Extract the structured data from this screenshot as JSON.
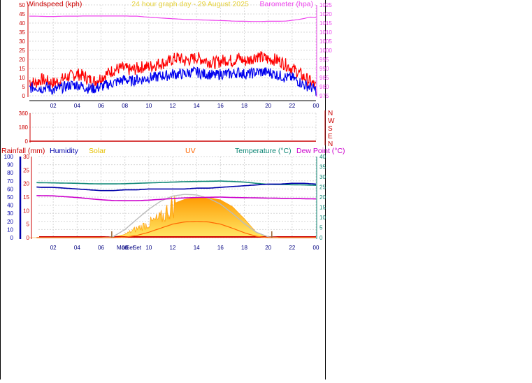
{
  "header": {
    "title": "24 hour graph day - 29 August 2025",
    "title_color": "#e6d23c"
  },
  "time_labels": [
    "02",
    "04",
    "06",
    "08",
    "10",
    "12",
    "14",
    "16",
    "18",
    "20",
    "22",
    "00"
  ],
  "colors": {
    "wind_gust": "#ff0000",
    "wind_avg": "#0000ee",
    "pressure": "#ee44ee",
    "direction": "#cc0000",
    "rainfall": "#cc0000",
    "humidity": "#0000aa",
    "solar": "#e6c000",
    "uv": "#ff6600",
    "temperature": "#118877",
    "dew_point": "#cc00cc",
    "grid": "#d8d8d8",
    "axis_frame": "#000000"
  },
  "chart_data": [
    {
      "type": "line",
      "name": "wind-pressure",
      "legend": {
        "left": "Windspeed (kph)",
        "right": "Barometer (hpa)"
      },
      "x": [
        0,
        0.5,
        1,
        1.5,
        2,
        2.5,
        3,
        3.5,
        4,
        4.5,
        5,
        5.5,
        6,
        6.5,
        7,
        7.5,
        8,
        8.5,
        9,
        9.5,
        10,
        10.5,
        11,
        11.5,
        12,
        12.5,
        13,
        13.5,
        14,
        14.5,
        15,
        15.5,
        16,
        16.5,
        17,
        17.5,
        18,
        18.5,
        19,
        19.5,
        20,
        20.5,
        21,
        21.5,
        22,
        22.5,
        23,
        23.5,
        24
      ],
      "xlim": [
        0,
        24
      ],
      "y_left": {
        "ticks": [
          0,
          5,
          10,
          15,
          20,
          25,
          30,
          35,
          40,
          45,
          50
        ],
        "ylim": [
          0,
          50
        ]
      },
      "y_right": {
        "ticks": [
          975,
          980,
          985,
          990,
          995,
          1000,
          1005,
          1010,
          1015,
          1020,
          1025
        ],
        "ylim": [
          975,
          1025
        ]
      },
      "series": [
        {
          "name": "Gust",
          "axis": "left",
          "color": "#ff0000",
          "values": [
            8,
            7,
            9,
            8,
            7,
            8,
            10,
            11,
            12,
            11,
            9,
            8,
            10,
            12,
            14,
            15,
            15,
            14,
            15,
            16,
            16,
            17,
            18,
            18,
            20,
            21,
            19,
            20,
            21,
            20,
            19,
            18,
            19,
            20,
            19,
            21,
            19,
            20,
            22,
            21,
            20,
            20,
            19,
            17,
            15,
            13,
            10,
            8,
            5
          ]
        },
        {
          "name": "Average",
          "axis": "left",
          "color": "#0000ee",
          "values": [
            4,
            5,
            4,
            5,
            3,
            4,
            5,
            6,
            6,
            5,
            4,
            4,
            5,
            6,
            7,
            8,
            9,
            8,
            9,
            9,
            10,
            10,
            11,
            11,
            12,
            12,
            12,
            13,
            13,
            12,
            12,
            11,
            12,
            12,
            12,
            13,
            12,
            12,
            13,
            13,
            13,
            12,
            11,
            10,
            10,
            8,
            6,
            5,
            3
          ]
        },
        {
          "name": "Pressure",
          "axis": "right",
          "color": "#ee44ee",
          "values": [
            1018.8,
            1018.8,
            1018.7,
            1018.6,
            1018.6,
            1018.7,
            1018.8,
            1018.8,
            1018.8,
            1018.9,
            1018.9,
            1018.9,
            1018.9,
            1018.9,
            1018.9,
            1018.9,
            1018.9,
            1018.8,
            1018.8,
            1018.5,
            1018.2,
            1018.0,
            1017.8,
            1017.6,
            1017.4,
            1017.2,
            1017.0,
            1016.9,
            1016.8,
            1016.7,
            1016.6,
            1016.5,
            1016.4,
            1016.3,
            1016.1,
            1016.0,
            1016.0,
            1015.9,
            1015.9,
            1015.9,
            1016.0,
            1016.0,
            1016.0,
            1016.1,
            1016.5,
            1016.9,
            1017.5,
            1018.3,
            1018.0
          ]
        }
      ]
    },
    {
      "type": "line",
      "name": "wind-direction",
      "x": [
        0,
        24
      ],
      "xlim": [
        0,
        24
      ],
      "y_left": {
        "ticks": [
          0,
          180,
          360
        ],
        "ylim": [
          0,
          360
        ]
      },
      "compass_labels": [
        "N",
        "W",
        "S",
        "E",
        "N"
      ],
      "series": [
        {
          "name": "Direction",
          "color": "#cc0000",
          "values": [
            0,
            0
          ]
        }
      ]
    },
    {
      "type": "area",
      "name": "rain-humidity-solar-temp",
      "legend": {
        "rainfall": "Rainfall (mm)",
        "humidity": "Humidity",
        "solar": "Solar",
        "uv": "UV",
        "temperature": "Temperature (°C)",
        "dew_point": "Dew Point (°C)"
      },
      "xlim": [
        0,
        24
      ],
      "y_humidity": {
        "ticks": [
          0,
          10,
          20,
          30,
          40,
          50,
          60,
          70,
          80,
          90,
          100
        ],
        "ylim": [
          0,
          100
        ]
      },
      "y_rain": {
        "ticks": [
          0,
          5,
          10,
          15,
          20,
          25,
          30
        ],
        "ylim": [
          0,
          30
        ]
      },
      "y_temp": {
        "ticks": [
          0,
          5,
          10,
          15,
          20,
          25,
          30,
          35,
          40
        ],
        "ylim": [
          0,
          40
        ]
      },
      "moon_labels": [
        "Mon",
        "Set",
        "Set"
      ],
      "markers_x": [
        6.9,
        20.3
      ],
      "x": [
        0,
        1,
        2,
        3,
        4,
        5,
        6,
        7,
        8,
        9,
        10,
        11,
        12,
        13,
        14,
        15,
        16,
        17,
        18,
        19,
        20,
        21,
        22,
        23,
        24
      ],
      "series": [
        {
          "name": "Temperature",
          "axis": "temp",
          "color": "#118877",
          "values": [
            27.2,
            27.1,
            27.0,
            26.9,
            26.8,
            26.6,
            26.5,
            26.5,
            26.6,
            26.8,
            27.0,
            27.2,
            27.4,
            27.6,
            27.7,
            27.8,
            27.9,
            27.7,
            27.4,
            26.8,
            26.3,
            26.2,
            26.1,
            26.0,
            25.8
          ]
        },
        {
          "name": "Humidity",
          "axis": "humidity",
          "color": "#0000aa",
          "values": [
            63,
            62,
            62,
            61,
            60,
            59,
            58,
            58,
            59,
            59,
            60,
            60,
            60,
            60,
            61,
            61,
            62,
            63,
            64,
            65,
            66,
            66,
            67,
            67,
            66
          ]
        },
        {
          "name": "Dew Point",
          "axis": "temp",
          "color": "#cc00cc",
          "values": [
            20.8,
            20.7,
            20.6,
            20.2,
            19.8,
            19.2,
            18.7,
            18.3,
            18.2,
            18.2,
            18.5,
            18.9,
            19.3,
            19.6,
            19.8,
            19.9,
            20.0,
            19.8,
            19.7,
            19.6,
            19.5,
            19.4,
            19.3,
            19.2,
            19.1
          ]
        },
        {
          "name": "Solar",
          "axis": "rain",
          "color": "#e6c000",
          "values": [
            0,
            0,
            0,
            0,
            0,
            0,
            0,
            0.2,
            1.2,
            3.5,
            5.5,
            7.5,
            12.5,
            14.2,
            14.8,
            14.8,
            14.0,
            11.5,
            7.0,
            2.0,
            0.2,
            0,
            0,
            0,
            0
          ]
        },
        {
          "name": "Solar max",
          "axis": "rain",
          "color": "#bbbbbb",
          "values": [
            0,
            0,
            0,
            0,
            0,
            0,
            0,
            0.3,
            3.0,
            6.8,
            10.5,
            13.5,
            15.4,
            16.0,
            15.8,
            14.6,
            12.4,
            9.0,
            5.2,
            2.0,
            0.3,
            0,
            0,
            0,
            0
          ]
        },
        {
          "name": "UV",
          "axis": "rain",
          "color": "#ff6600",
          "values": [
            0,
            0,
            0,
            0,
            0,
            0,
            0,
            0,
            0.2,
            0.8,
            2.0,
            3.5,
            5.0,
            5.8,
            6.0,
            5.8,
            5.0,
            3.5,
            1.8,
            0.5,
            0,
            0,
            0,
            0,
            0
          ]
        }
      ]
    }
  ]
}
